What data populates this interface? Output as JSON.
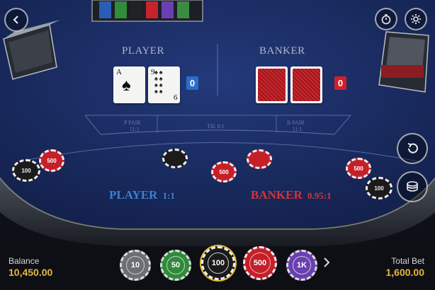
{
  "table": {
    "player_label": "PLAYER",
    "banker_label": "BANKER",
    "player_score": "0",
    "banker_score": "0",
    "player_cards": [
      "A",
      "9"
    ],
    "player_card_bottom_rank": "6",
    "p_pair_line1": "P PAIR",
    "p_pair_line2": "11:1",
    "tie_label": "TIE 8:1",
    "b_pair_line1": "B PAIR",
    "b_pair_line2": "11:1",
    "player_bet_name": "PLAYER",
    "player_bet_odds": "1:1",
    "banker_bet_name": "BANKER",
    "banker_bet_odds": "0.95:1"
  },
  "table_chips": [
    "100",
    "500",
    "500",
    "500",
    "100"
  ],
  "footer": {
    "balance_label": "Balance",
    "balance_value": "10,450.00",
    "total_bet_label": "Total Bet",
    "total_bet_value": "1,600.00"
  },
  "chip_tray": [
    {
      "value": "10",
      "color": "#6b6e74"
    },
    {
      "value": "50",
      "color": "#2e8b3a"
    },
    {
      "value": "100",
      "color": "#1a1a1a"
    },
    {
      "value": "500",
      "color": "#c5202a"
    },
    {
      "value": "1K",
      "color": "#6a3fb1"
    }
  ],
  "icons": {
    "back": "chevron-left-icon",
    "timer": "stopwatch-icon",
    "settings": "gear-icon",
    "undo": "undo-icon",
    "chips_stack": "chip-stack-icon",
    "next": "chevron-right-icon"
  },
  "colors": {
    "felt": "#1d2f66",
    "player_score_bg": "#2a6fc7",
    "banker_score_bg": "#d0202a",
    "player_bet_text": "#3d7fd0",
    "banker_bet_text": "#d2343a",
    "gold": "#e7b73a"
  }
}
